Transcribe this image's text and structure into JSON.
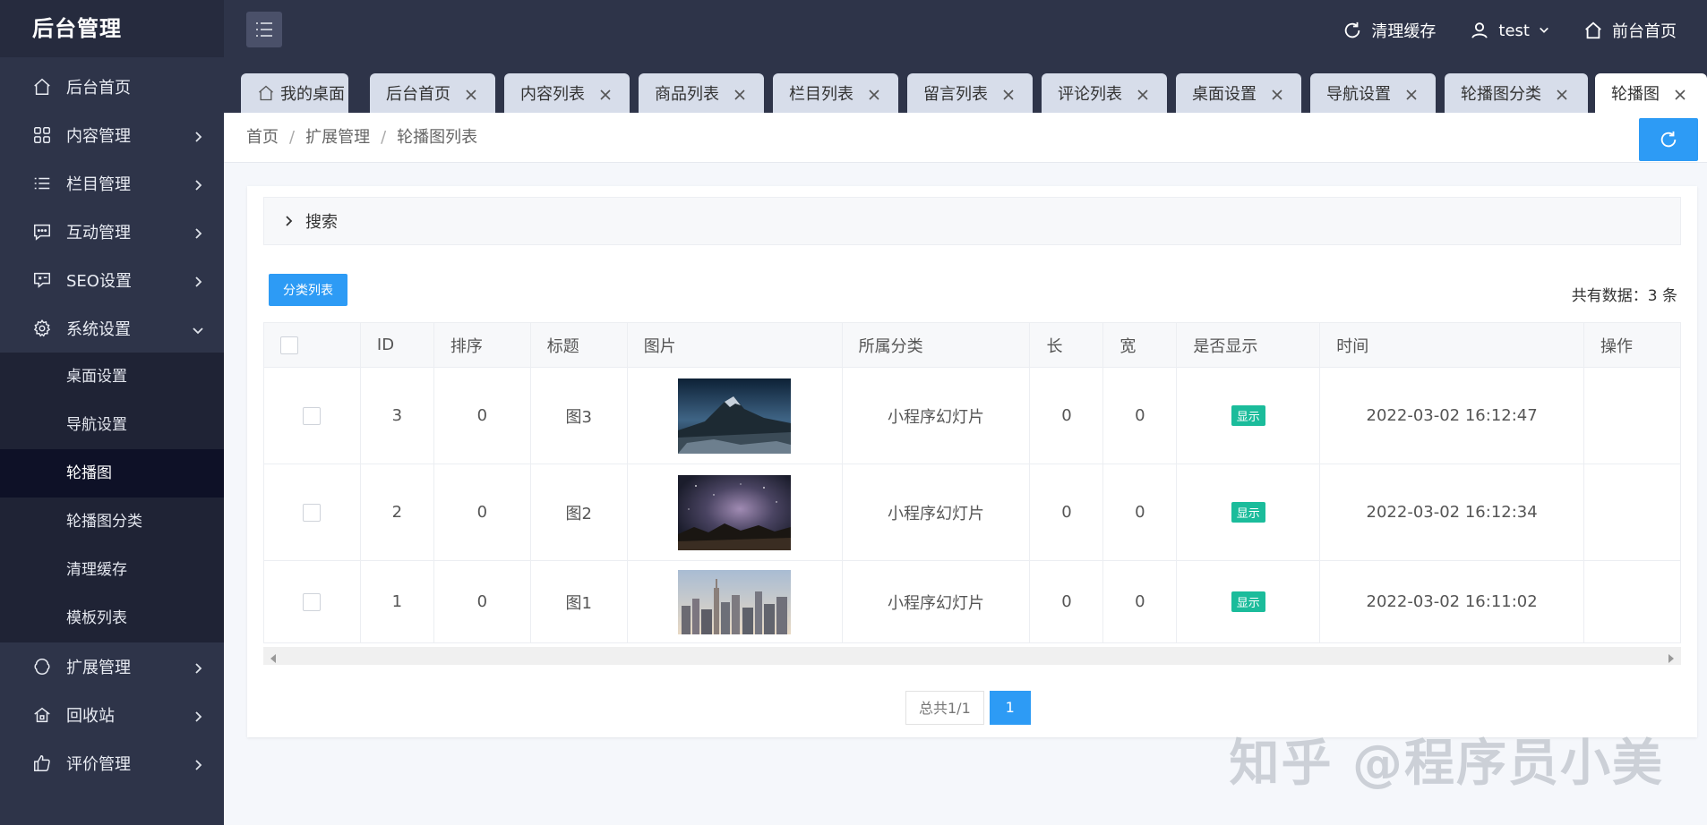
{
  "brand": "后台管理",
  "sidebar": {
    "items": [
      {
        "label": "后台首页"
      },
      {
        "label": "内容管理"
      },
      {
        "label": "栏目管理"
      },
      {
        "label": "互动管理"
      },
      {
        "label": "SEO设置"
      },
      {
        "label": "系统设置"
      }
    ],
    "submenu": [
      {
        "label": "桌面设置"
      },
      {
        "label": "导航设置"
      },
      {
        "label": "轮播图"
      },
      {
        "label": "轮播图分类"
      },
      {
        "label": "清理缓存"
      },
      {
        "label": "模板列表"
      }
    ],
    "items_after": [
      {
        "label": "扩展管理"
      },
      {
        "label": "回收站"
      },
      {
        "label": "评价管理"
      }
    ]
  },
  "header": {
    "clear_cache": "清理缓存",
    "user": "test",
    "frontend": "前台首页"
  },
  "tabs": [
    {
      "label": "我的桌面"
    },
    {
      "label": "后台首页"
    },
    {
      "label": "内容列表"
    },
    {
      "label": "商品列表"
    },
    {
      "label": "栏目列表"
    },
    {
      "label": "留言列表"
    },
    {
      "label": "评论列表"
    },
    {
      "label": "桌面设置"
    },
    {
      "label": "导航设置"
    },
    {
      "label": "轮播图分类"
    },
    {
      "label": "轮播图"
    }
  ],
  "breadcrumb": [
    "首页",
    "扩展管理",
    "轮播图列表"
  ],
  "search": {
    "label": "搜索"
  },
  "toolbar": {
    "category_button": "分类列表",
    "total": "共有数据：3 条"
  },
  "table": {
    "headers": [
      "",
      "ID",
      "排序",
      "标题",
      "图片",
      "所属分类",
      "长",
      "宽",
      "是否显示",
      "时间",
      "操作"
    ],
    "rows": [
      {
        "id": "3",
        "order": "0",
        "title": "图3",
        "category": "小程序幻灯片",
        "length": "0",
        "width": "0",
        "show": "显示",
        "time": "2022-03-02 16:12:47"
      },
      {
        "id": "2",
        "order": "0",
        "title": "图2",
        "category": "小程序幻灯片",
        "length": "0",
        "width": "0",
        "show": "显示",
        "time": "2022-03-02 16:12:34"
      },
      {
        "id": "1",
        "order": "0",
        "title": "图1",
        "category": "小程序幻灯片",
        "length": "0",
        "width": "0",
        "show": "显示",
        "time": "2022-03-02 16:11:02"
      }
    ]
  },
  "pagination": {
    "total": "总共1/1",
    "current": "1"
  },
  "watermark": "知乎 @程序员小美"
}
